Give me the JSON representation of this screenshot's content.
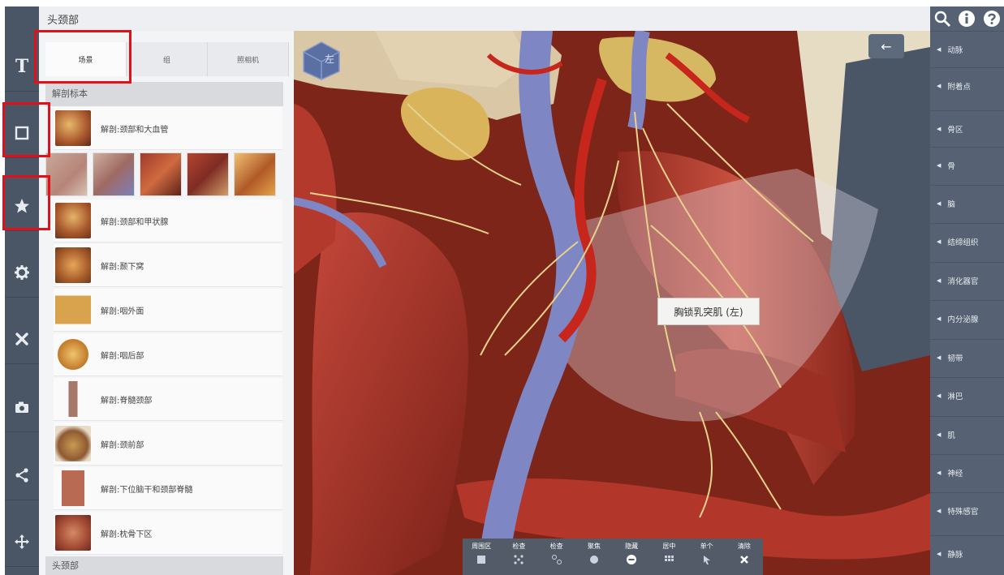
{
  "title": "头颈部",
  "tabs": [
    "场景",
    "组",
    "照相机"
  ],
  "section_label": "解剖标本",
  "items": [
    "解剖:颈部和大血管",
    "解剖:颈部和甲状腺",
    "解剖:颞下窝",
    "解剖:咽外面",
    "解剖:咽后部",
    "解剖:脊髓颈部",
    "解剖:颈前部",
    "解剖:下位脑干和颈部脊髓",
    "解剖:枕骨下区"
  ],
  "bottom_section_label": "头颈部",
  "tooltip": "胸锁乳突肌 (左)",
  "cube_label": "左",
  "bottom_tools": [
    "周围区",
    "检查",
    "检查",
    "聚焦",
    "隐藏",
    "居中",
    "单个",
    "清除"
  ],
  "right_menu": [
    "动脉",
    "附着点",
    "骨区",
    "骨",
    "脑",
    "结缔组织",
    "消化器官",
    "内分泌腺",
    "韧带",
    "淋巴",
    "肌",
    "神经",
    "特殊感官",
    "静脉"
  ],
  "left_icons": [
    "text-tool-icon",
    "square-select-icon",
    "star-favorite-icon",
    "settings-gear-icon",
    "tools-cross-icon",
    "camera-icon",
    "share-icon",
    "move-arrows-icon"
  ],
  "colors": {
    "highlight": "#e3101a",
    "sidebar": "#566273",
    "leftbar": "#4a5566",
    "muscle": "#a8322a",
    "vein": "#7f86c4",
    "nerve": "#e6d28c"
  }
}
